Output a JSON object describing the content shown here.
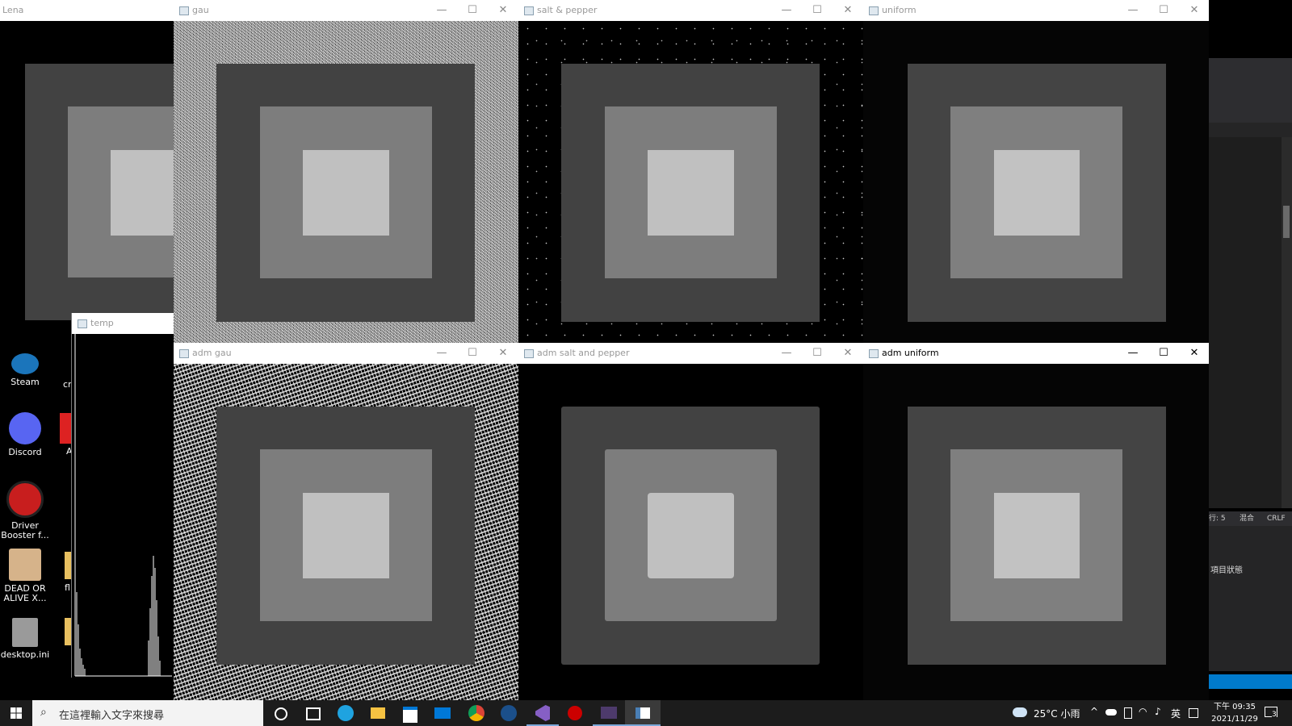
{
  "windows": {
    "lena": {
      "title": "Lena"
    },
    "gau": {
      "title": "gau"
    },
    "salt_pepper": {
      "title": "salt & pepper"
    },
    "uniform": {
      "title": "uniform"
    },
    "temp": {
      "title": "temp"
    },
    "adm_gau": {
      "title": "adm gau"
    },
    "adm_salt_pepper": {
      "title": "adm salt and pepper"
    },
    "adm_uniform": {
      "title": "adm uniform"
    }
  },
  "controls": {
    "minimize": "—",
    "maximize": "☐",
    "close": "✕"
  },
  "desktop": {
    "steam": "Steam",
    "discord": "Discord",
    "driver_booster": "Driver Booster f...",
    "dead_or_alive": "DEAD OR ALIVE X...",
    "desktop_ini": "desktop.ini",
    "cr_partial": "cr",
    "a_partial": "A",
    "fl_partial": "fl"
  },
  "ide_panel": {
    "status_line": "行: 5",
    "status_mixed": "混合",
    "status_eol": "CRLF",
    "project_status": "項目狀態"
  },
  "taskbar": {
    "search_placeholder": "在這裡輸入文字來搜尋",
    "weather": "25°C 小雨",
    "ime": "英",
    "time_label": "下午 09:35",
    "date": "2021/11/29",
    "notification_count": "3",
    "icons": [
      "start-icon",
      "search-icon",
      "cortana-icon",
      "task-view-icon",
      "edge-icon",
      "file-explorer-icon",
      "store-icon",
      "mail-icon",
      "chrome-icon",
      "steam-icon",
      "visual-studio-icon",
      "asus-icon",
      "terminal-icon",
      "image-viewer-icon"
    ]
  },
  "colors": {
    "dark_gray": "#424242",
    "mid_gray": "#7d7d7d",
    "light_gray": "#c0c0c0",
    "titlebar": "#ffffff",
    "taskbar": "#1c1c1c",
    "accent_blue": "#0078d7"
  }
}
